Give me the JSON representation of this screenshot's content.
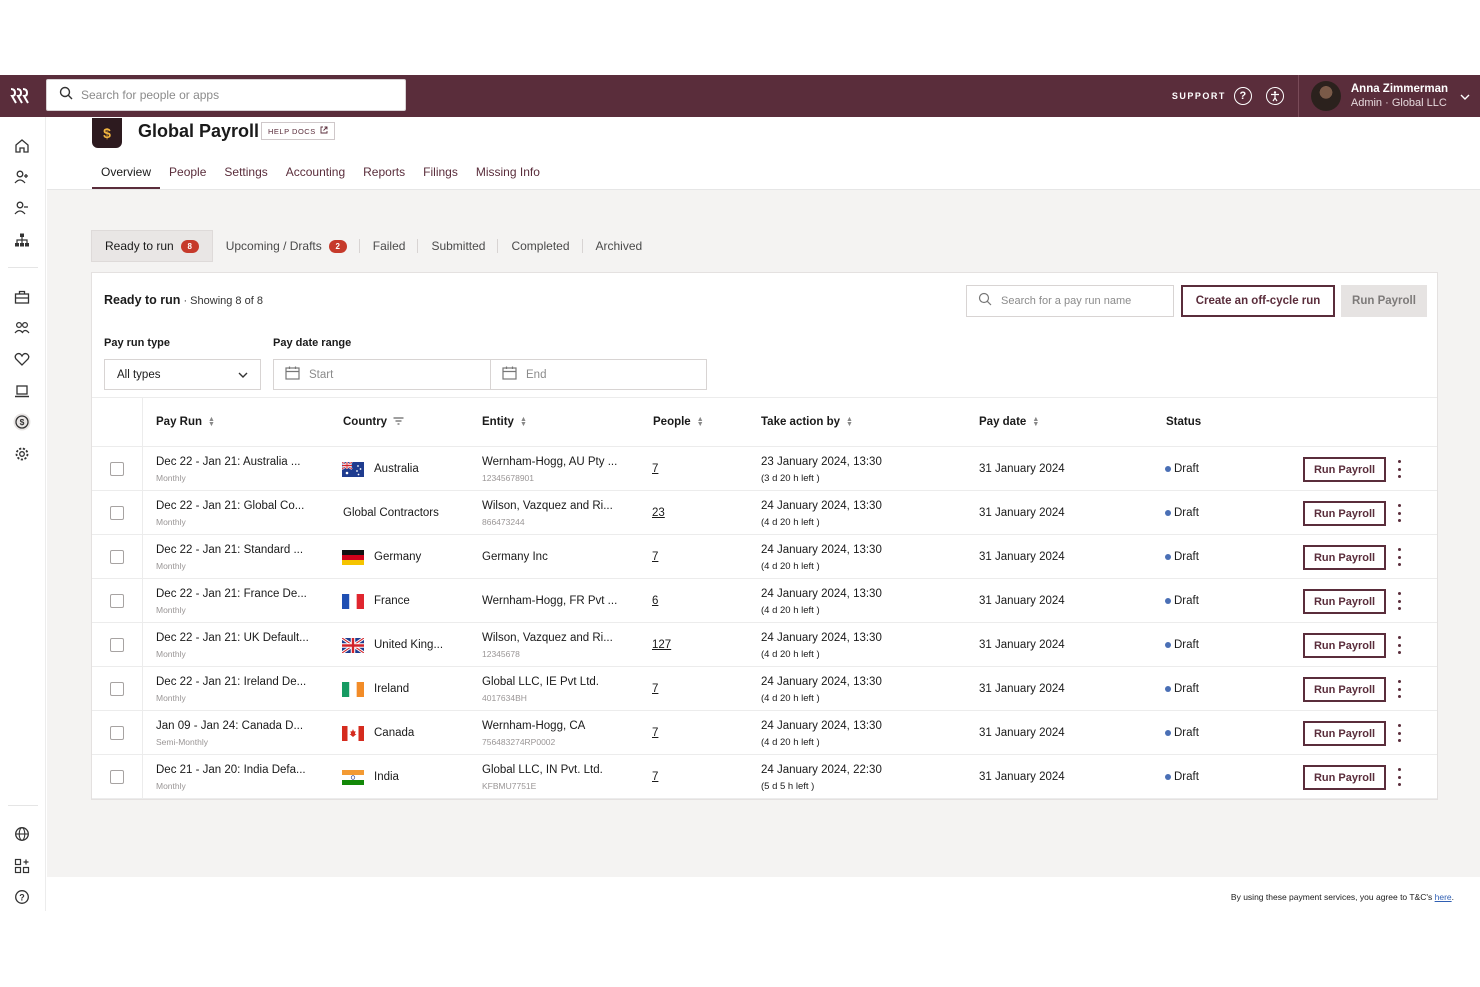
{
  "global_search": {
    "placeholder": "Search for people or apps"
  },
  "topbar": {
    "support_label": "SUPPORT",
    "user_name": "Anna Zimmerman",
    "user_role": "Admin · Global LLC"
  },
  "app": {
    "title": "Global Payroll",
    "help_docs": "HELP DOCS"
  },
  "main_tabs": [
    "Overview",
    "People",
    "Settings",
    "Accounting",
    "Reports",
    "Filings",
    "Missing Info"
  ],
  "status_tabs": [
    {
      "label": "Ready to run",
      "badge": "8"
    },
    {
      "label": "Upcoming / Drafts",
      "badge": "2"
    },
    {
      "label": "Failed"
    },
    {
      "label": "Submitted"
    },
    {
      "label": "Completed"
    },
    {
      "label": "Archived"
    }
  ],
  "card": {
    "title": "Ready to run",
    "showing": " · Showing 8 of 8",
    "search_placeholder": "Search for a pay run name",
    "create_button": "Create an off-cycle run",
    "run_button": "Run Payroll"
  },
  "filters": {
    "pay_run_type_label": "Pay run type",
    "pay_run_type_value": "All types",
    "pay_date_range_label": "Pay date range",
    "start_placeholder": "Start",
    "end_placeholder": "End"
  },
  "table": {
    "headers": {
      "pay_run": "Pay Run",
      "country": "Country",
      "entity": "Entity",
      "people": "People",
      "take_action": "Take action by",
      "pay_date": "Pay date",
      "status": "Status"
    },
    "row_button": "Run Payroll",
    "rows": [
      {
        "name": "Dec 22 - Jan 21: Australia ...",
        "freq": "Monthly",
        "country": "Australia",
        "flag": "au",
        "entity": "Wernham-Hogg, AU Pty ...",
        "entity_id": "12345678901",
        "people": "7",
        "take": "23 January 2024, 13:30",
        "left": "(3 d 20 h left )",
        "pay_date": "31 January 2024",
        "status": "Draft"
      },
      {
        "name": "Dec 22 - Jan 21: Global Co...",
        "freq": "Monthly",
        "country": "Global Contractors",
        "flag": "",
        "entity": "Wilson, Vazquez and Ri...",
        "entity_id": "866473244",
        "people": "23",
        "take": "24 January 2024, 13:30",
        "left": "(4 d 20 h left )",
        "pay_date": "31 January 2024",
        "status": "Draft"
      },
      {
        "name": "Dec 22 - Jan 21: Standard ...",
        "freq": "Monthly",
        "country": "Germany",
        "flag": "de",
        "entity": "Germany Inc",
        "entity_id": "",
        "people": "7",
        "take": "24 January 2024, 13:30",
        "left": "(4 d 20 h left )",
        "pay_date": "31 January 2024",
        "status": "Draft"
      },
      {
        "name": "Dec 22 - Jan 21: France De...",
        "freq": "Monthly",
        "country": "France",
        "flag": "fr",
        "entity": "Wernham-Hogg, FR Pvt ...",
        "entity_id": "",
        "people": "6",
        "take": "24 January 2024, 13:30",
        "left": "(4 d 20 h left )",
        "pay_date": "31 January 2024",
        "status": "Draft"
      },
      {
        "name": "Dec 22 - Jan 21: UK Default...",
        "freq": "Monthly",
        "country": "United King...",
        "flag": "uk",
        "entity": "Wilson, Vazquez and Ri...",
        "entity_id": "12345678",
        "people": "127",
        "take": "24 January 2024, 13:30",
        "left": "(4 d 20 h left )",
        "pay_date": "31 January 2024",
        "status": "Draft"
      },
      {
        "name": "Dec 22 - Jan 21: Ireland De...",
        "freq": "Monthly",
        "country": "Ireland",
        "flag": "ie",
        "entity": "Global LLC, IE Pvt Ltd.",
        "entity_id": "4017634BH",
        "people": "7",
        "take": "24 January 2024, 13:30",
        "left": "(4 d 20 h left )",
        "pay_date": "31 January 2024",
        "status": "Draft"
      },
      {
        "name": "Jan 09 - Jan 24: Canada D...",
        "freq": "Semi-Monthly",
        "country": "Canada",
        "flag": "ca",
        "entity": "Wernham-Hogg, CA",
        "entity_id": "756483274RP0002",
        "people": "7",
        "take": "24 January 2024, 13:30",
        "left": "(4 d 20 h left )",
        "pay_date": "31 January 2024",
        "status": "Draft"
      },
      {
        "name": "Dec 21 - Jan 20: India Defa...",
        "freq": "Monthly",
        "country": "India",
        "flag": "in",
        "entity": "Global LLC, IN Pvt. Ltd.",
        "entity_id": "KFBMU7751E",
        "people": "7",
        "take": "24 January 2024, 22:30",
        "left": "(5 d 5 h left )",
        "pay_date": "31 January 2024",
        "status": "Draft"
      }
    ]
  },
  "footer": {
    "text": "By using these payment services, you agree to T&C's ",
    "link": "here",
    "period": "."
  },
  "colors": {
    "brand": "#5a2d3b",
    "badge": "#c63a2b",
    "status_dot": "#4a6fb5"
  }
}
